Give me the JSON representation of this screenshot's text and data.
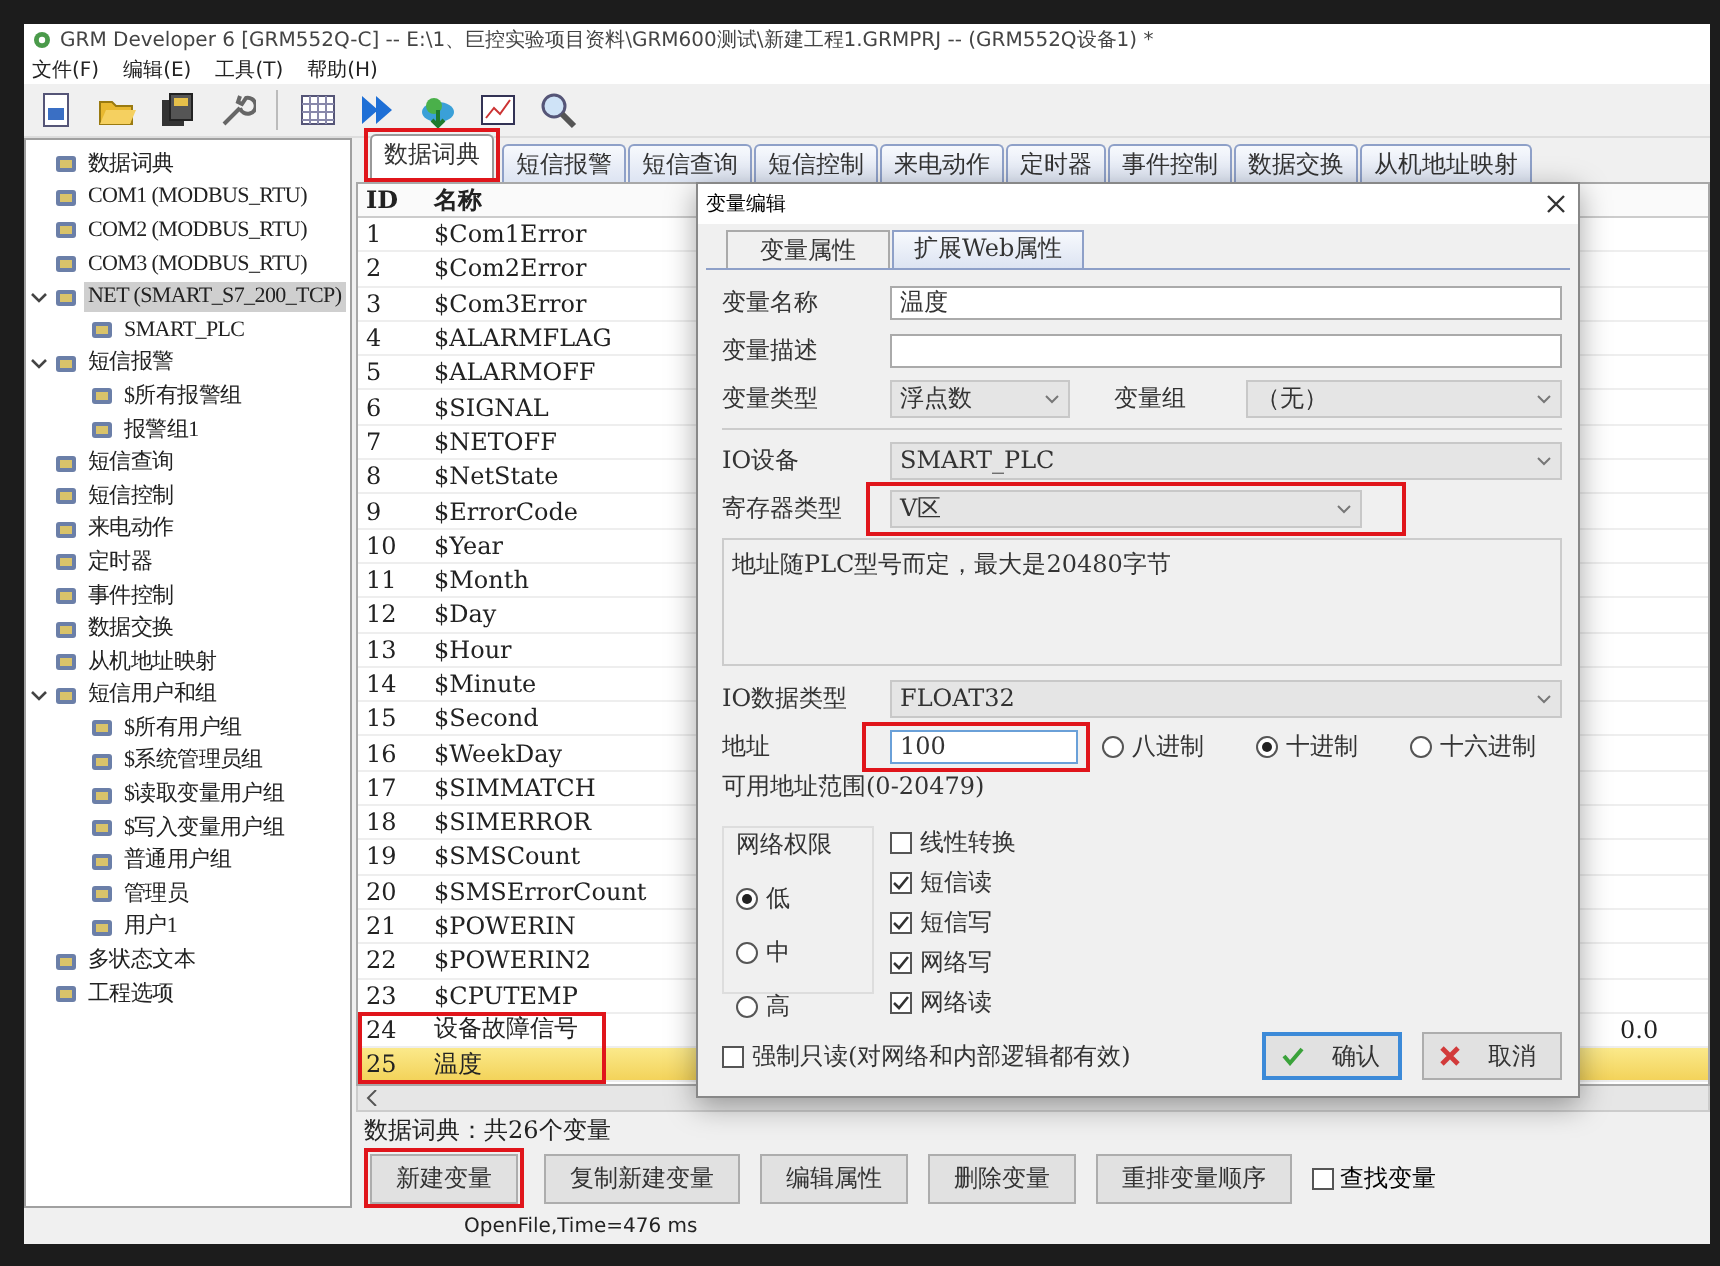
{
  "window": {
    "title": "GRM Developer 6 [GRM552Q-C]  -- E:\\1、巨控实验项目资料\\GRM600测试\\新建工程1.GRMPRJ -- (GRM552Q设备1) *"
  },
  "menu": [
    "文件(F)",
    "编辑(E)",
    "工具(T)",
    "帮助(H)"
  ],
  "tree": [
    {
      "label": "数据词典",
      "selected": false
    },
    {
      "label": "COM1 (MODBUS_RTU)",
      "selected": false
    },
    {
      "label": "COM2 (MODBUS_RTU)",
      "selected": false
    },
    {
      "label": "COM3 (MODBUS_RTU)",
      "selected": false
    },
    {
      "label": "NET (SMART_S7_200_TCP)",
      "selected": true,
      "expanded": true,
      "children": [
        {
          "label": "SMART_PLC",
          "selected": false
        }
      ]
    },
    {
      "label": "短信报警",
      "selected": false,
      "expanded": true,
      "children": [
        {
          "label": "$所有报警组",
          "selected": false
        },
        {
          "label": "报警组1",
          "selected": false
        }
      ]
    },
    {
      "label": "短信查询",
      "selected": false
    },
    {
      "label": "短信控制",
      "selected": false
    },
    {
      "label": "来电动作",
      "selected": false
    },
    {
      "label": "定时器",
      "selected": false
    },
    {
      "label": "事件控制",
      "selected": false
    },
    {
      "label": "数据交换",
      "selected": false
    },
    {
      "label": "从机地址映射",
      "selected": false
    },
    {
      "label": "短信用户和组",
      "selected": false,
      "expanded": true,
      "children": [
        {
          "label": "$所有用户组",
          "selected": false
        },
        {
          "label": "$系统管理员组",
          "selected": false
        },
        {
          "label": "$读取变量用户组",
          "selected": false
        },
        {
          "label": "$写入变量用户组",
          "selected": false
        },
        {
          "label": "普通用户组",
          "selected": false
        },
        {
          "label": "管理员",
          "selected": false
        },
        {
          "label": "用户1",
          "selected": false
        }
      ]
    },
    {
      "label": "多状态文本",
      "selected": false
    },
    {
      "label": "工程选项",
      "selected": false
    }
  ],
  "tabs": [
    {
      "label": "数据词典",
      "selected": true,
      "highlighted": true
    },
    {
      "label": "短信报警",
      "selected": false,
      "highlighted": false
    },
    {
      "label": "短信查询",
      "selected": false,
      "highlighted": false
    },
    {
      "label": "短信控制",
      "selected": false,
      "highlighted": false
    },
    {
      "label": "来电动作",
      "selected": false,
      "highlighted": false
    },
    {
      "label": "定时器",
      "selected": false,
      "highlighted": false
    },
    {
      "label": "事件控制",
      "selected": false,
      "highlighted": false
    },
    {
      "label": "数据交换",
      "selected": false,
      "highlighted": false
    },
    {
      "label": "从机地址映射",
      "selected": false,
      "highlighted": false
    }
  ],
  "table": {
    "columns": [
      "ID",
      "名称"
    ],
    "rows": [
      {
        "id": "1",
        "name": "$Com1Error",
        "selected": false,
        "highlighted": false
      },
      {
        "id": "2",
        "name": "$Com2Error",
        "selected": false,
        "highlighted": false
      },
      {
        "id": "3",
        "name": "$Com3Error",
        "selected": false,
        "highlighted": false
      },
      {
        "id": "4",
        "name": "$ALARMFLAG",
        "selected": false,
        "highlighted": false
      },
      {
        "id": "5",
        "name": "$ALARMOFF",
        "selected": false,
        "highlighted": false
      },
      {
        "id": "6",
        "name": "$SIGNAL",
        "selected": false,
        "highlighted": false
      },
      {
        "id": "7",
        "name": "$NETOFF",
        "selected": false,
        "highlighted": false
      },
      {
        "id": "8",
        "name": "$NetState",
        "selected": false,
        "highlighted": false
      },
      {
        "id": "9",
        "name": "$ErrorCode",
        "selected": false,
        "highlighted": false
      },
      {
        "id": "10",
        "name": "$Year",
        "selected": false,
        "highlighted": false
      },
      {
        "id": "11",
        "name": "$Month",
        "selected": false,
        "highlighted": false
      },
      {
        "id": "12",
        "name": "$Day",
        "selected": false,
        "highlighted": false
      },
      {
        "id": "13",
        "name": "$Hour",
        "selected": false,
        "highlighted": false
      },
      {
        "id": "14",
        "name": "$Minute",
        "selected": false,
        "highlighted": false
      },
      {
        "id": "15",
        "name": "$Second",
        "selected": false,
        "highlighted": false
      },
      {
        "id": "16",
        "name": "$WeekDay",
        "selected": false,
        "highlighted": false
      },
      {
        "id": "17",
        "name": "$SIMMATCH",
        "selected": false,
        "highlighted": false
      },
      {
        "id": "18",
        "name": "$SIMERROR",
        "selected": false,
        "highlighted": false
      },
      {
        "id": "19",
        "name": "$SMSCount",
        "selected": false,
        "highlighted": false
      },
      {
        "id": "20",
        "name": "$SMSErrorCount",
        "selected": false,
        "highlighted": false
      },
      {
        "id": "21",
        "name": "$POWERIN",
        "selected": false,
        "highlighted": false
      },
      {
        "id": "22",
        "name": "$POWERIN2",
        "selected": false,
        "highlighted": false
      },
      {
        "id": "23",
        "name": "$CPUTEMP",
        "selected": false,
        "highlighted": false
      },
      {
        "id": "24",
        "name": "设备故障信号",
        "selected": false,
        "highlighted": true,
        "column_3": "0.0"
      },
      {
        "id": "25",
        "name": "温度",
        "selected": true,
        "highlighted": true
      }
    ]
  },
  "summary": "数据词典：共26个变量",
  "buttons": [
    {
      "label": "新建变量",
      "highlighted": true
    },
    {
      "label": "复制新建变量",
      "highlighted": false
    },
    {
      "label": "编辑属性",
      "highlighted": false
    },
    {
      "label": "删除变量",
      "highlighted": false
    },
    {
      "label": "重排变量顺序",
      "highlighted": false
    }
  ],
  "find_checkbox": {
    "label": "查找变量",
    "checked": false
  },
  "status_bar": "OpenFile,Time=476 ms",
  "dialog": {
    "title": "变量编辑",
    "tabs": [
      {
        "label": "变量属性",
        "selected": true
      },
      {
        "label": "扩展Web属性",
        "selected": false
      }
    ],
    "name": {
      "label": "变量名称",
      "value": "温度"
    },
    "description": {
      "label": "变量描述"
    },
    "type": {
      "label": "变量类型",
      "value": "浮点数"
    },
    "group": {
      "label": "变量组",
      "value": "（无）"
    },
    "io_device": {
      "label": "IO设备",
      "value": "SMART_PLC"
    },
    "register_type": {
      "label": "寄存器类型",
      "value": "V区",
      "highlighted": true
    },
    "note": "地址随PLC型号而定，最大是20480字节",
    "io_data_type": {
      "label": "IO数据类型",
      "value": "FLOAT32"
    },
    "address": {
      "label": "地址",
      "value": "100",
      "highlighted": true
    },
    "radix": [
      {
        "label": "八进制",
        "selected": false
      },
      {
        "label": "十进制",
        "selected": true
      },
      {
        "label": "十六进制",
        "selected": false
      }
    ],
    "address_range": "可用地址范围(0-20479)",
    "permission": {
      "title": "网络权限",
      "options": [
        {
          "label": "低",
          "selected": true
        },
        {
          "label": "中",
          "selected": false
        },
        {
          "label": "高",
          "selected": false
        }
      ]
    },
    "options": [
      {
        "label": "线性转换",
        "checked": false
      },
      {
        "label": "短信读",
        "checked": true
      },
      {
        "label": "短信写",
        "checked": true
      },
      {
        "label": "网络写",
        "checked": true
      },
      {
        "label": "网络读",
        "checked": true
      }
    ],
    "read_only": {
      "label": "强制只读(对网络和内部逻辑都有效)",
      "checked": false
    },
    "buttons": [
      {
        "label": "确认",
        "kind": "confirm"
      },
      {
        "label": "取消",
        "kind": "cancel"
      }
    ]
  }
}
